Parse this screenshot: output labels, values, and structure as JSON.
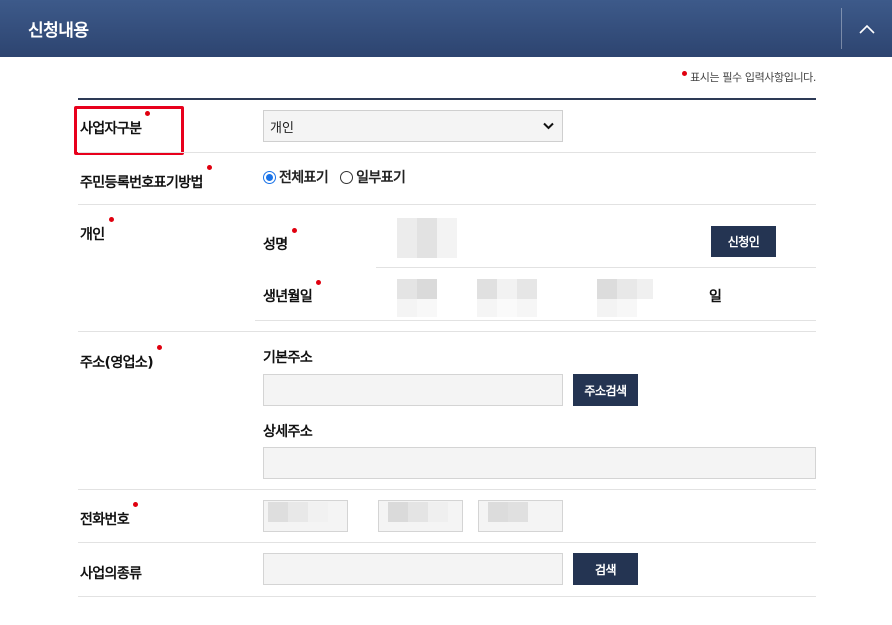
{
  "header": {
    "title": "신청내용",
    "collapse_icon": "chevron-up-icon"
  },
  "required_note": "표시는 필수 입력사항입니다.",
  "colors": {
    "header_bg": "#2d4470",
    "required_dot": "#e0000f",
    "button_bg": "#243452",
    "highlight": "#e8001c"
  },
  "form": {
    "business_type": {
      "label": "사업자구분",
      "selected": "개인"
    },
    "rrn_display": {
      "label": "주민등록번호표기방법",
      "options": [
        {
          "label": "전체표기",
          "checked": true
        },
        {
          "label": "일부표기",
          "checked": false
        }
      ]
    },
    "individual": {
      "label": "개인",
      "name_label": "성명",
      "applicant_button": "신청인",
      "birth_label": "생년월일",
      "day_suffix": "일"
    },
    "address": {
      "label": "주소(영업소)",
      "basic_label": "기본주소",
      "search_button": "주소검색",
      "detail_label": "상세주소"
    },
    "phone": {
      "label": "전화번호"
    },
    "business_kind": {
      "label": "사업의종류",
      "search_button": "검색"
    }
  }
}
